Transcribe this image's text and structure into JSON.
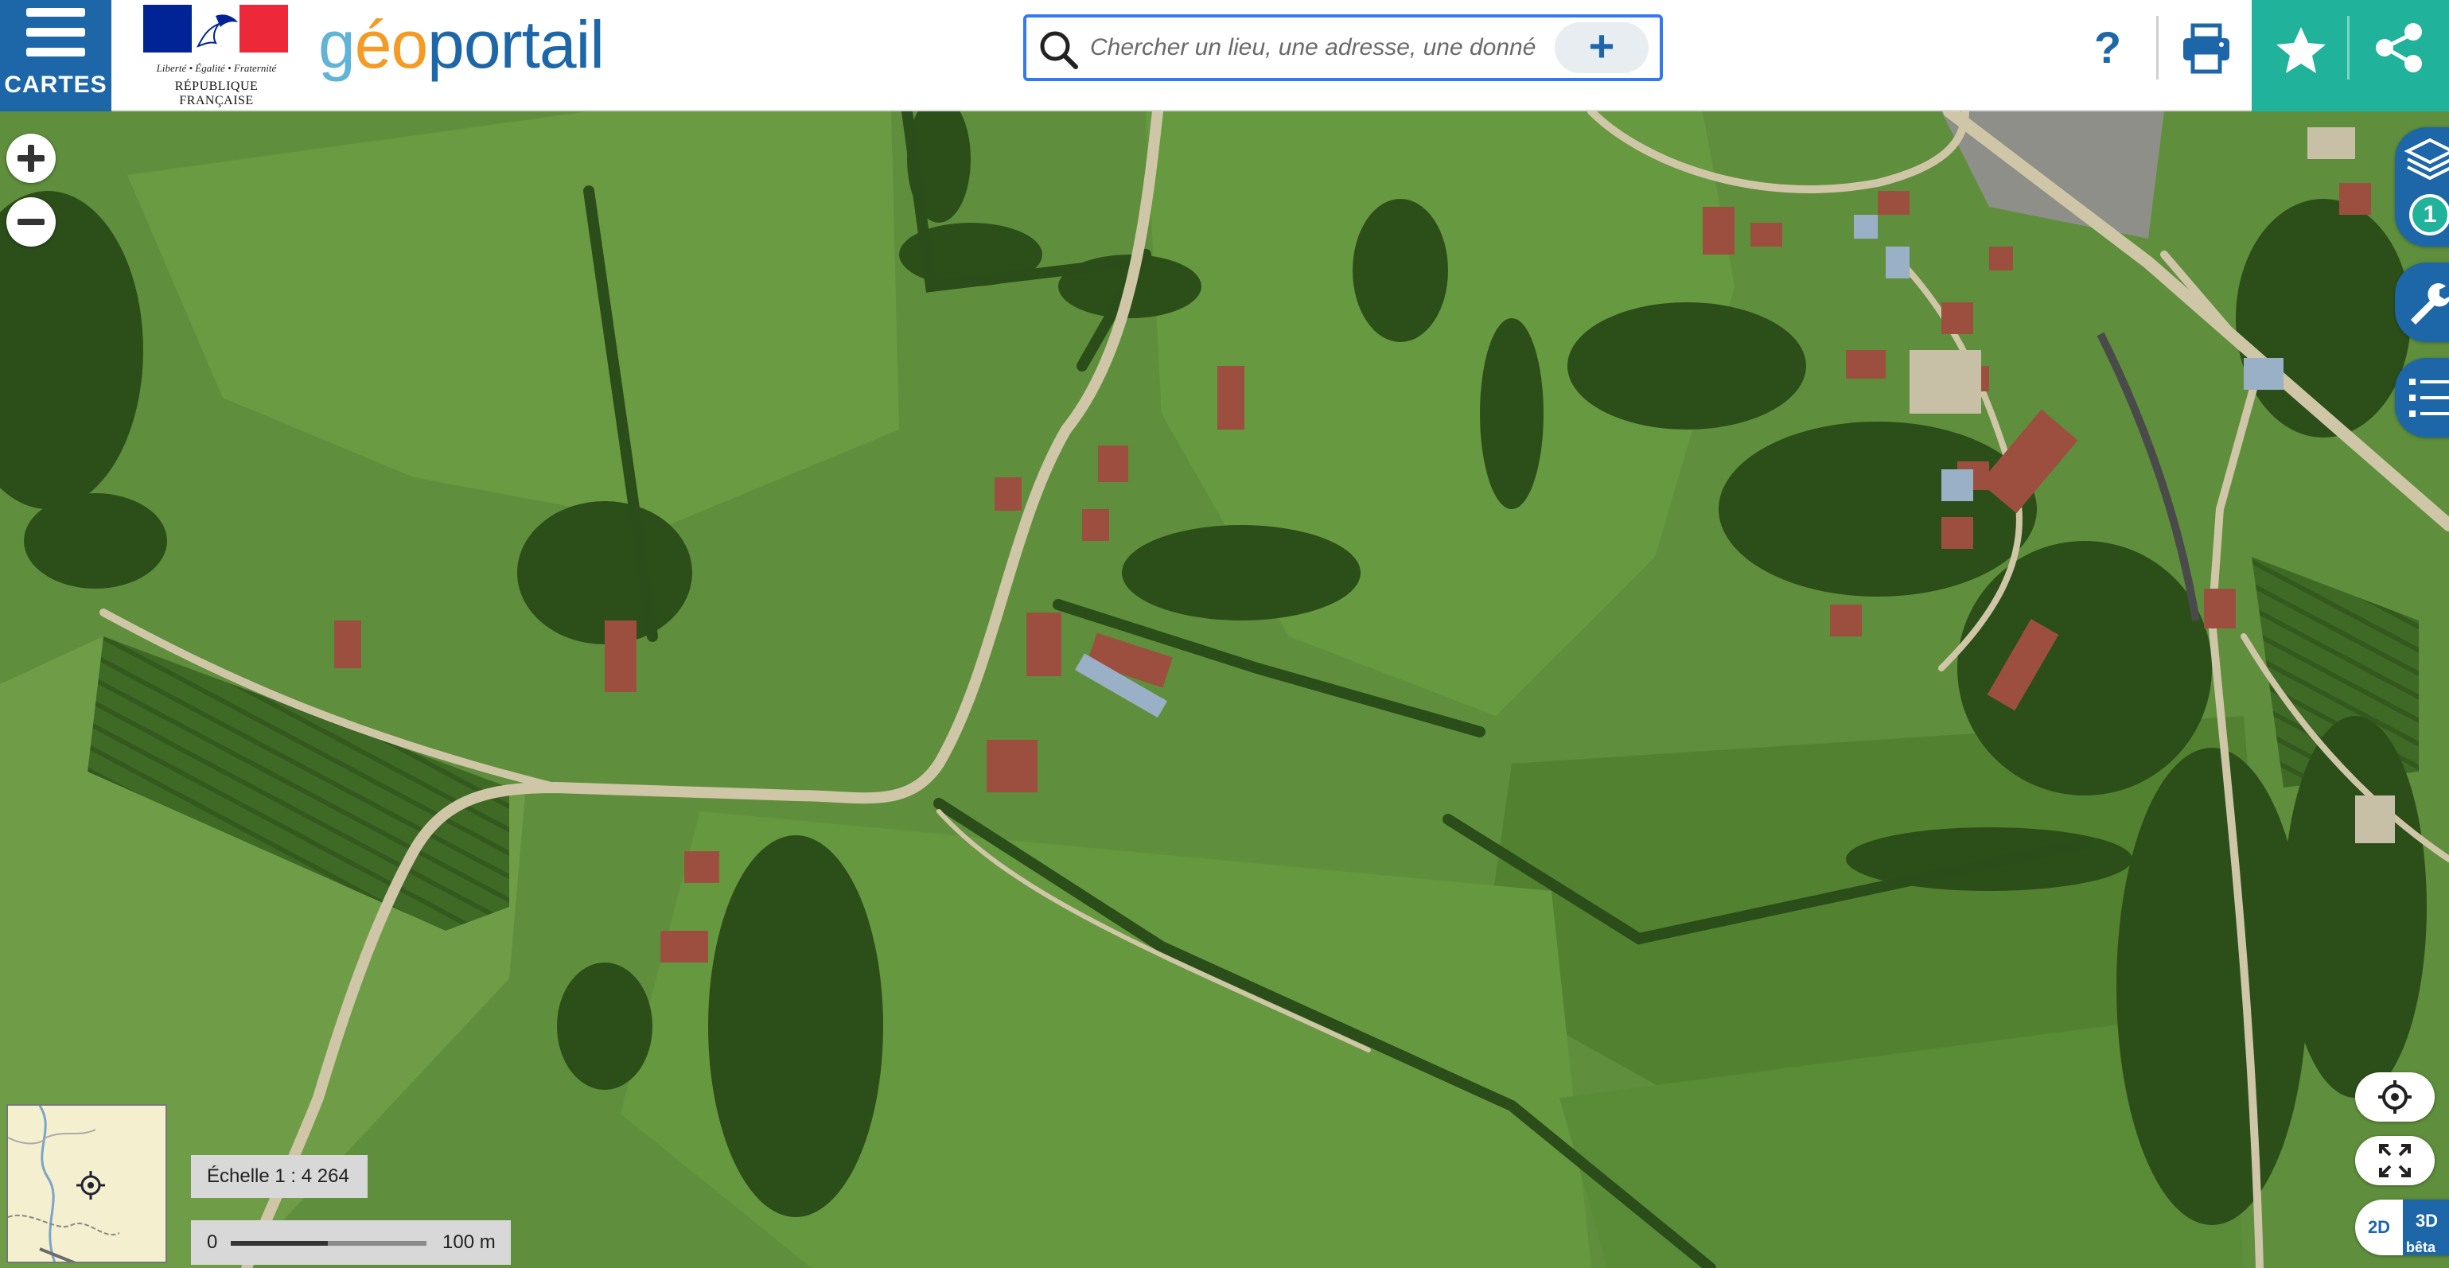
{
  "header": {
    "cartes_label": "CARTES",
    "rf_motto": "Liberté • Égalité • Fraternité",
    "rf_name": "RÉPUBLIQUE FRANÇAISE",
    "logo_parts": [
      "g",
      "é",
      "o",
      "portail"
    ],
    "search_placeholder": "Chercher un lieu, une adresse, une donnée",
    "search_plus": "+",
    "help_label": "?",
    "colors": {
      "primary_blue": "#1d67a8",
      "teal": "#20b29a",
      "logo_light_blue": "#61b3d8",
      "logo_orange": "#f59a23"
    },
    "icons": [
      "menu-icon",
      "search-icon",
      "print-icon",
      "star-icon",
      "share-icon"
    ]
  },
  "map": {
    "zoom_icons": [
      "zoom-in-icon",
      "zoom-out-icon"
    ],
    "side_tabs": [
      {
        "name": "layers",
        "icon": "layers-icon",
        "badge": "1"
      },
      {
        "name": "tools",
        "icon": "wrench-icon"
      },
      {
        "name": "legend",
        "icon": "list-icon"
      }
    ],
    "controls": {
      "locate_icon": "locate-icon",
      "fullscreen_icon": "fullscreen-icon",
      "view_2d": "2D",
      "view_3d": "3D",
      "view_3d_badge": "bêta"
    },
    "scale": {
      "text": "Échelle 1 : 4 264",
      "bar_start": "0",
      "bar_end": "100 m"
    }
  }
}
